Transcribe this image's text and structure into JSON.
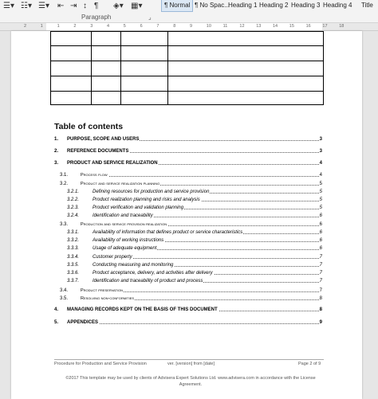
{
  "ribbon": {
    "group_label": "Paragraph",
    "styles": [
      {
        "label": "¶ Normal",
        "active": true
      },
      {
        "label": "¶ No Spac..."
      },
      {
        "label": "Heading 1"
      },
      {
        "label": "Heading 2"
      },
      {
        "label": "Heading 3"
      },
      {
        "label": "Heading 4"
      },
      {
        "label": "Title"
      }
    ]
  },
  "ruler": {
    "ticks": [
      "2",
      "1",
      "1",
      "2",
      "3",
      "4",
      "5",
      "6",
      "7",
      "8",
      "9",
      "10",
      "11",
      "12",
      "13",
      "14",
      "15",
      "16",
      "17",
      "18"
    ]
  },
  "toc": {
    "title": "Table of contents",
    "entries": [
      {
        "level": 1,
        "num": "1.",
        "text": "PURPOSE, SCOPE AND USERS",
        "page": "3"
      },
      {
        "level": 1,
        "num": "2.",
        "text": "REFERENCE DOCUMENTS",
        "page": "3"
      },
      {
        "level": 1,
        "num": "3.",
        "text": "PRODUCT AND SERVICE REALIZATION",
        "page": "4"
      },
      {
        "level": 2,
        "num": "3.1.",
        "text": "Process flow",
        "page": "4"
      },
      {
        "level": 2,
        "num": "3.2.",
        "text": "Product and service realization planning",
        "page": "5"
      },
      {
        "level": 3,
        "num": "3.2.1.",
        "text": "Defining resources for production and service provision",
        "page": "5"
      },
      {
        "level": 3,
        "num": "3.2.2.",
        "text": "Product realization planning and risks and analysis",
        "page": "5"
      },
      {
        "level": 3,
        "num": "3.2.3.",
        "text": "Product verification and validation planning",
        "page": "5"
      },
      {
        "level": 3,
        "num": "3.2.4.",
        "text": "Identification and traceability",
        "page": "6"
      },
      {
        "level": 2,
        "num": "3.3.",
        "text": "Production and service provision realization",
        "page": "6"
      },
      {
        "level": 3,
        "num": "3.3.1.",
        "text": "Availability of information that defines product or service characteristics",
        "page": "6"
      },
      {
        "level": 3,
        "num": "3.3.2.",
        "text": "Availability of working instructions",
        "page": "6"
      },
      {
        "level": 3,
        "num": "3.3.3.",
        "text": "Usage of adequate equipment",
        "page": "6"
      },
      {
        "level": 3,
        "num": "3.3.4.",
        "text": "Customer property",
        "page": "7"
      },
      {
        "level": 3,
        "num": "3.3.5.",
        "text": "Conducting measuring and monitoring",
        "page": "7"
      },
      {
        "level": 3,
        "num": "3.3.6.",
        "text": "Product acceptance, delivery, and activities after delivery",
        "page": "7"
      },
      {
        "level": 3,
        "num": "3.3.7.",
        "text": "Identification and traceability of product and process",
        "page": "7"
      },
      {
        "level": 2,
        "num": "3.4.",
        "text": "Product preservation",
        "page": "7"
      },
      {
        "level": 2,
        "num": "3.5.",
        "text": "Resolving non-conformities",
        "page": "8"
      },
      {
        "level": 1,
        "num": "4.",
        "text": "MANAGING RECORDS KEPT ON THE BASIS OF THIS DOCUMENT",
        "page": "8"
      },
      {
        "level": 1,
        "num": "5.",
        "text": "APPENDICES",
        "page": "9"
      }
    ]
  },
  "footer": {
    "left": "Procedure for Production and Service Provision",
    "center": "ver. [version] from [date]",
    "right": "Page 2 of 9",
    "copyright": "©2017 This template may be used by clients of Advisera Expert Solutions Ltd. www.advisera.com in accordance with the License Agreement."
  }
}
